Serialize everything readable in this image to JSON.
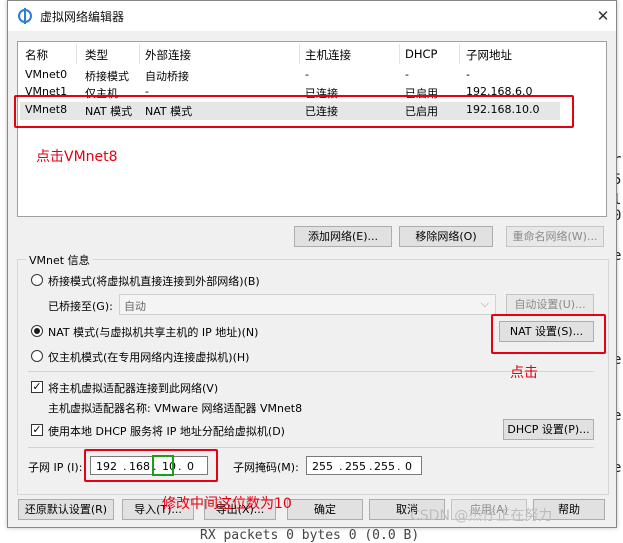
{
  "window": {
    "title": "虚拟网络编辑器",
    "close_glyph": "✕"
  },
  "table": {
    "headers": [
      "名称",
      "类型",
      "外部连接",
      "主机连接",
      "DHCP",
      "子网地址"
    ],
    "rows": [
      [
        "VMnet0",
        "桥接模式",
        "自动桥接",
        "-",
        "-",
        "-"
      ],
      [
        "VMnet1",
        "仅主机...",
        "-",
        "已连接",
        "已启用",
        "192.168.6.0"
      ],
      [
        "VMnet8",
        "NAT 模式",
        "NAT 模式",
        "已连接",
        "已启用",
        "192.168.10.0"
      ]
    ]
  },
  "table_buttons": {
    "add": "添加网络(E)...",
    "remove": "移除网络(O)",
    "rename": "重命名网络(W)..."
  },
  "vmnet_info": {
    "title": "VMnet 信息",
    "bridge_label": "桥接模式(将虚拟机直接连接到外部网络)(B)",
    "bridged_to_label": "已桥接至(G):",
    "bridged_to_value": "自动",
    "auto_settings": "自动设置(U)...",
    "nat_label": "NAT 模式(与虚拟机共享主机的 IP 地址)(N)",
    "nat_settings": "NAT 设置(S)...",
    "hostonly_label": "仅主机模式(在专用网络内连接虚拟机)(H)",
    "connect_adapter_label": "将主机虚拟适配器连接到此网络(V)",
    "adapter_name_label": "主机虚拟适配器名称: VMware 网络适配器 VMnet8",
    "dhcp_label": "使用本地 DHCP 服务将 IP 地址分配给虚拟机(D)",
    "dhcp_settings": "DHCP 设置(P)...",
    "subnet_ip_label": "子网 IP (I):",
    "subnet_ip": [
      "192",
      "168",
      "10",
      "0"
    ],
    "subnet_mask_label": "子网掩码(M):",
    "subnet_mask": [
      "255",
      "255",
      "255",
      "0"
    ]
  },
  "bottom_buttons": {
    "restore": "还原默认设置(R)",
    "import": "导入(T)...",
    "export": "导出(X)...",
    "ok": "确定",
    "cancel": "取消",
    "apply": "应用(A)",
    "help": "帮助"
  },
  "annotations": {
    "click_vmnet8": "点击VMnet8",
    "click": "点击",
    "change_middle": "修改中间这位数为10"
  },
  "watermark": "CSDN @杰仔正在努力",
  "background": {
    "right_chars": [
      "r",
      "5",
      "l",
      "0",
      "e",
      "e",
      "e",
      "e"
    ],
    "bottom_text": "RX packets 0  bytes 0 (0.0 B)"
  },
  "colors": {
    "annotation_red": "#e60012",
    "highlight_green": "#1a9f1a",
    "selected_row": "#e6e6e6"
  }
}
